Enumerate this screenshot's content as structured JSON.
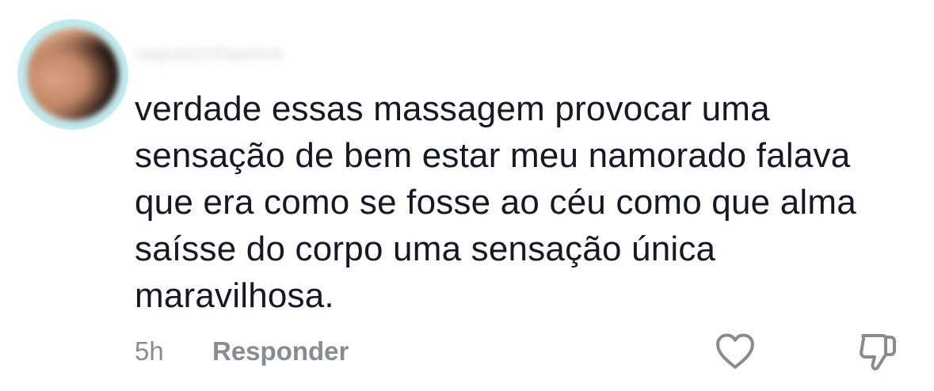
{
  "comment": {
    "username": "raquelzinhaolive",
    "text_lines": [
      "verdade essas massagem provocar uma",
      "sensação de bem estar meu namorado falava",
      "que era como se fosse ao céu como que alma",
      "saísse do corpo uma sensação única",
      "maravilhosa."
    ],
    "time": "5h",
    "reply_label": "Responder",
    "icons": {
      "like": "heart-outline-icon",
      "dislike": "thumbs-down-outline-icon"
    }
  },
  "colors": {
    "text": "#161823",
    "meta": "#8a8b91",
    "background": "#ffffff"
  }
}
